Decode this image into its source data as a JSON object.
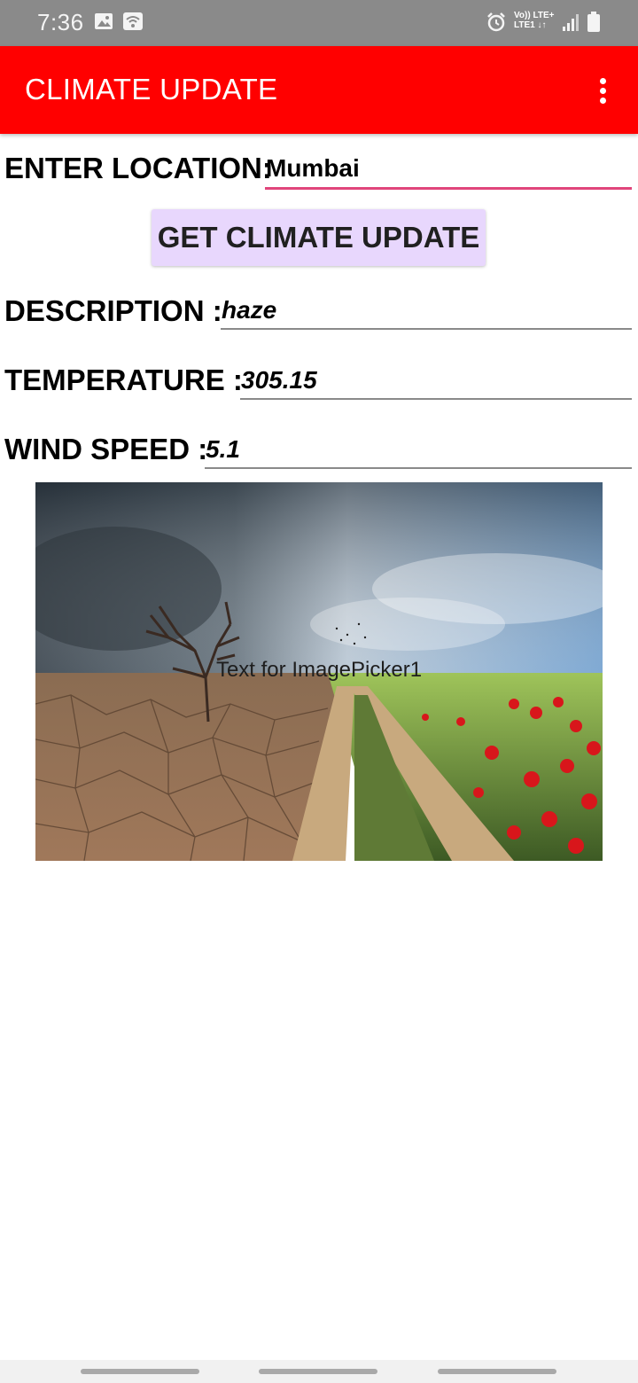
{
  "status_bar": {
    "time": "7:36",
    "network_line1": "Vo)) LTE+",
    "network_line2": "LTE1 ↓↑",
    "icons": [
      "image-icon",
      "wifi-icon",
      "alarm-icon",
      "signal-icon",
      "battery-icon"
    ]
  },
  "app_bar": {
    "title": "CLIMATE UPDATE",
    "color": "#ff0000",
    "menu_icon": "more-vertical-icon"
  },
  "location": {
    "label": "ENTER LOCATION:",
    "value": "Mumbai"
  },
  "get_button": {
    "label": "GET CLIMATE UPDATE",
    "color": "#e8d7fd"
  },
  "description": {
    "label": "DESCRIPTION :",
    "value": "haze"
  },
  "temperature": {
    "label": "TEMPERATURE :",
    "value": "305.15"
  },
  "wind_speed": {
    "label": "WIND SPEED :",
    "value": "5.1"
  },
  "image_picker": {
    "text": "Text for ImagePicker1"
  },
  "colors": {
    "accent_underline": "#e0457b"
  }
}
